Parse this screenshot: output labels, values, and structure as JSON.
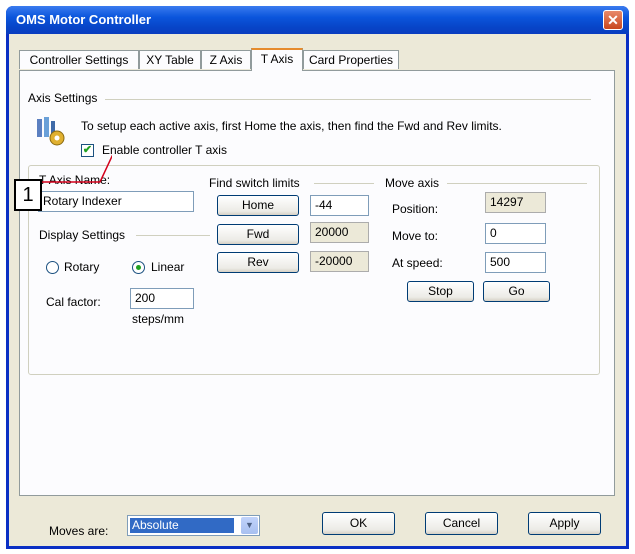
{
  "window": {
    "title": "OMS Motor Controller"
  },
  "tabs": [
    "Controller Settings",
    "XY Table",
    "Z Axis",
    "T Axis",
    "Card Properties"
  ],
  "axis_settings": {
    "heading": "Axis Settings",
    "instruction": "To setup each active axis, first Home the axis, then find the Fwd and Rev limits.",
    "enable_label": "Enable controller T axis",
    "enable_checked": true,
    "callout": "1"
  },
  "axis_name": {
    "label": "T Axis Name:",
    "value": "Rotary Indexer"
  },
  "display_settings": {
    "heading": "Display Settings",
    "options": [
      "Rotary",
      "Linear"
    ],
    "selected": "Linear",
    "cal_label": "Cal factor:",
    "cal_value": "200",
    "cal_units": "steps/mm"
  },
  "find_limits": {
    "heading": "Find switch limits",
    "home_label": "Home",
    "home_value": "-44",
    "fwd_label": "Fwd",
    "fwd_value": "20000",
    "rev_label": "Rev",
    "rev_value": "-20000"
  },
  "move_axis": {
    "heading": "Move axis",
    "position_label": "Position:",
    "position_value": "14297",
    "moveto_label": "Move to:",
    "moveto_value": "0",
    "speed_label": "At speed:",
    "speed_value": "500",
    "stop_label": "Stop",
    "go_label": "Go"
  },
  "footer": {
    "moves_label": "Moves are:",
    "moves_value": "Absolute",
    "ok_label": "OK",
    "cancel_label": "Cancel",
    "apply_label": "Apply"
  }
}
